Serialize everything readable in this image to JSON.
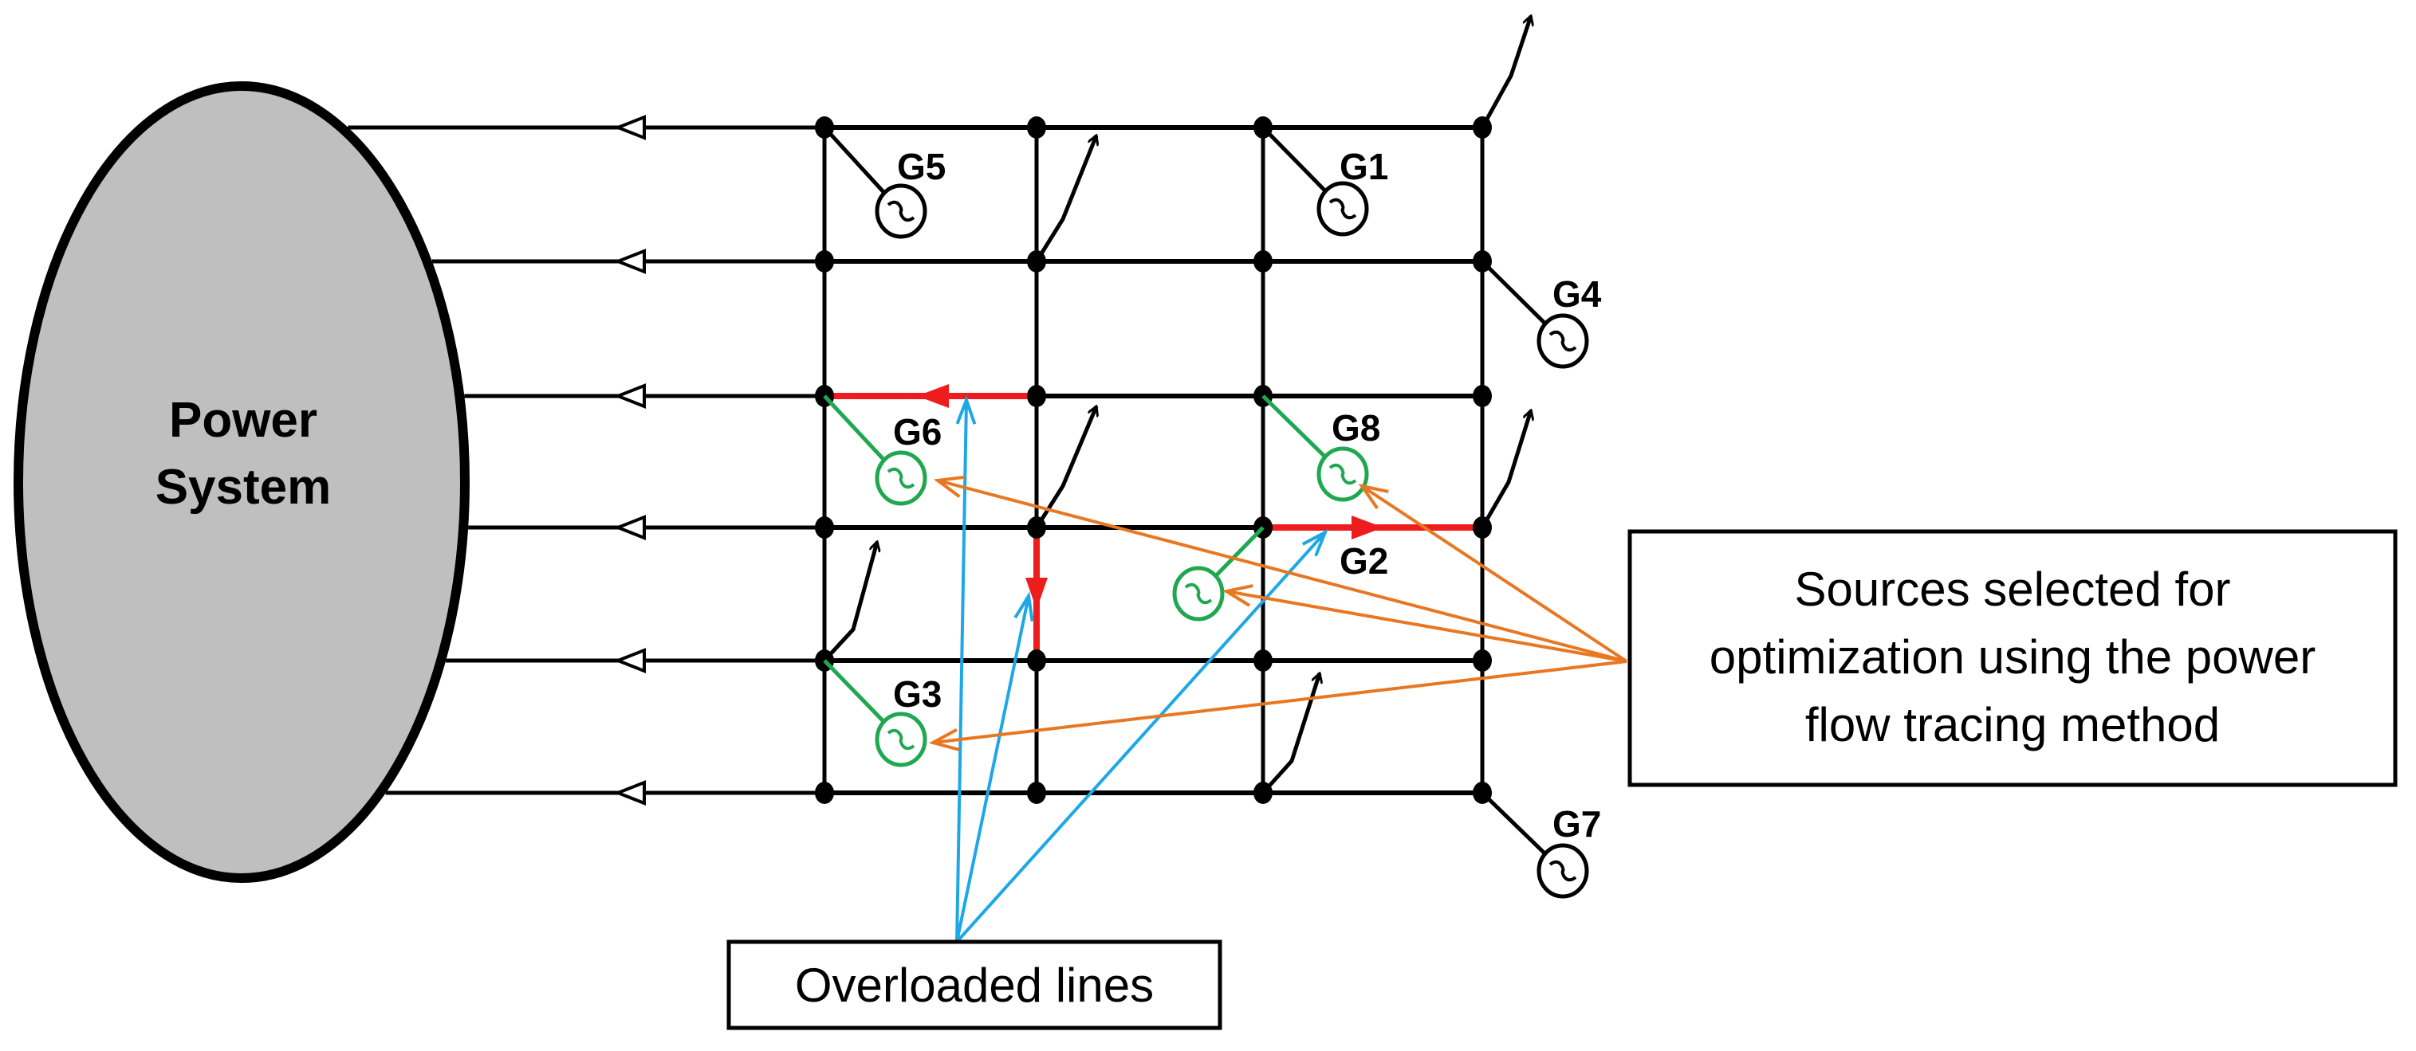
{
  "power_system": {
    "label_lines": [
      "Power",
      "System"
    ]
  },
  "generators": [
    {
      "id": "G5",
      "label": "G5",
      "selected": false
    },
    {
      "id": "G1",
      "label": "G1",
      "selected": false
    },
    {
      "id": "G4",
      "label": "G4",
      "selected": false
    },
    {
      "id": "G6",
      "label": "G6",
      "selected": true
    },
    {
      "id": "G8",
      "label": "G8",
      "selected": true
    },
    {
      "id": "G2",
      "label": "G2",
      "selected": true
    },
    {
      "id": "G3",
      "label": "G3",
      "selected": true
    },
    {
      "id": "G7",
      "label": "G7",
      "selected": false
    }
  ],
  "callouts": {
    "sources": {
      "lines": [
        "Sources selected for",
        "optimization using the power",
        "flow tracing method"
      ]
    },
    "overloaded": {
      "lines": [
        "Overloaded lines"
      ]
    }
  },
  "colors": {
    "line": "#000000",
    "overloaded": "#ee1c1c",
    "selected_source": "#1fa84f",
    "source_pointer": "#e87722",
    "overload_pointer": "#1ea7e6",
    "power_system_fill": "#bfbfbf"
  }
}
